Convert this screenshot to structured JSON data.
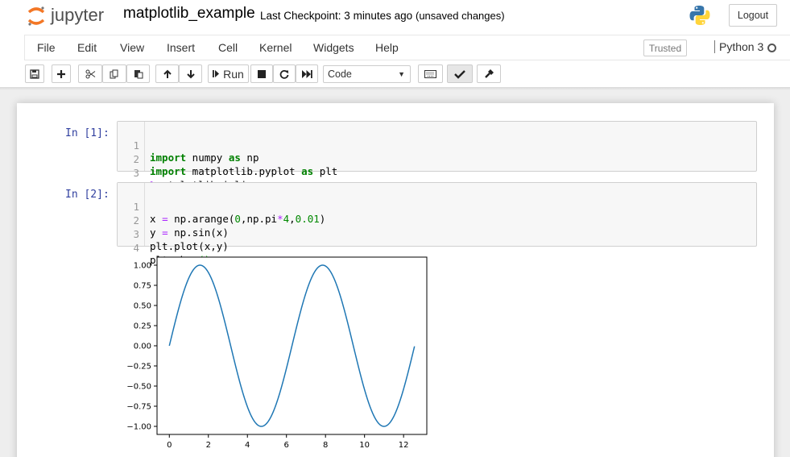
{
  "header": {
    "logo_text": "jupyter",
    "notebook_name": "matplotlib_example",
    "checkpoint": "Last Checkpoint: 3 minutes ago",
    "autosave": "(unsaved changes)",
    "logout_label": "Logout"
  },
  "menubar": {
    "items": [
      "File",
      "Edit",
      "View",
      "Insert",
      "Cell",
      "Kernel",
      "Widgets",
      "Help"
    ],
    "trusted_label": "Trusted",
    "kernel_name": "Python 3"
  },
  "toolbar": {
    "run_label": "Run",
    "cell_type": "Code",
    "icons": [
      "save-icon",
      "plus-icon",
      "cut-icon",
      "copy-icon",
      "paste-icon",
      "arrow-up-icon",
      "arrow-down-icon",
      "step-forward-icon",
      "stop-icon",
      "restart-icon",
      "fast-forward-icon",
      "keyboard-icon",
      "check-icon",
      "wrench-icon"
    ]
  },
  "cells": [
    {
      "prompt": "In [1]:",
      "lines": [
        {
          "n": "1",
          "code": "import numpy as np"
        },
        {
          "n": "2",
          "code": "import matplotlib.pyplot as plt"
        },
        {
          "n": "3",
          "code": "%matplotlib inline"
        }
      ]
    },
    {
      "prompt": "In [2]:",
      "lines": [
        {
          "n": "1",
          "code": "x = np.arange(0,np.pi*4,0.01)"
        },
        {
          "n": "2",
          "code": "y = np.sin(x)"
        },
        {
          "n": "3",
          "code": "plt.plot(x,y)"
        },
        {
          "n": "4",
          "code": "plt.show()"
        }
      ]
    }
  ],
  "chart_data": {
    "type": "line",
    "function": "sin",
    "x_start": 0,
    "x_end": 12.566,
    "x_step": 0.01,
    "xlim": [
      -0.63,
      13.19
    ],
    "ylim": [
      -1.1,
      1.1
    ],
    "xticks": [
      "0",
      "2",
      "4",
      "6",
      "8",
      "10",
      "12"
    ],
    "xtick_values": [
      0,
      2,
      4,
      6,
      8,
      10,
      12
    ],
    "yticks": [
      "1.00",
      "0.75",
      "0.50",
      "0.25",
      "0.00",
      "−0.25",
      "−0.50",
      "−0.75",
      "−1.00"
    ],
    "ytick_values": [
      1,
      0.75,
      0.5,
      0.25,
      0,
      -0.25,
      -0.5,
      -0.75,
      -1
    ],
    "line_color": "#1f77b4",
    "grid": false
  },
  "colors": {
    "prompt": "#303f9f",
    "keyword": "#008000",
    "magic": "#aa22ff",
    "number": "#008800"
  }
}
